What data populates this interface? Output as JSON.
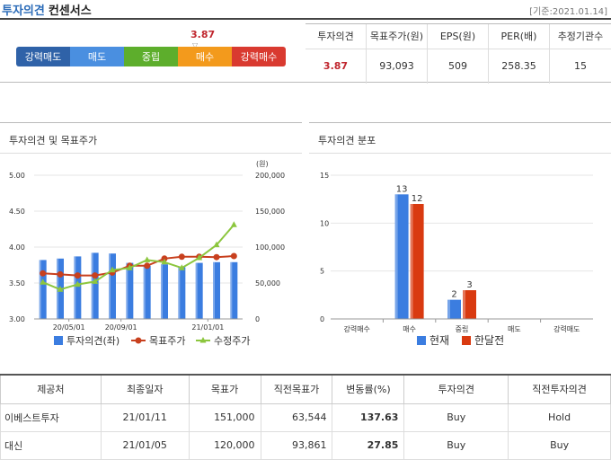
{
  "header": {
    "title": "투자의견",
    "subtitle": "컨센서스",
    "base_date": "[기준:2021.01.14]"
  },
  "consensus": {
    "current_value": "3.87",
    "opinion_scale": [
      "강력매도",
      "매도",
      "중립",
      "매수",
      "강력매수"
    ],
    "opinion_colors": [
      "#2f62a8",
      "#4a8fe0",
      "#5dae2c",
      "#f39a1c",
      "#d93a30"
    ],
    "stats_headers": [
      "투자의견",
      "목표주가(원)",
      "EPS(원)",
      "PER(배)",
      "추정기관수"
    ],
    "stats_values": [
      "3.87",
      "93,093",
      "509",
      "258.35",
      "15"
    ]
  },
  "left_panel": {
    "title": "투자의견 및 목표주가",
    "right_unit": "(원)",
    "legend": [
      "투자의견(좌)",
      "목표주가",
      "수정주가"
    ]
  },
  "right_panel": {
    "title": "투자의견 분포",
    "legend": [
      "현재",
      "한달전"
    ]
  },
  "chart_data": [
    {
      "type": "bar",
      "title": "투자의견 및 목표주가",
      "y_left_ticks": [
        "3.00",
        "3.50",
        "4.00",
        "4.50",
        "5.00"
      ],
      "y_left_range": [
        3.0,
        5.0
      ],
      "y_right_ticks": [
        "0",
        "50,000",
        "100,000",
        "150,000",
        "200,000"
      ],
      "y_right_range": [
        0,
        200000
      ],
      "x_ticks": [
        "20/05/01",
        "20/09/01",
        "21/01/01"
      ],
      "series": [
        {
          "name": "투자의견(좌)",
          "type": "bar",
          "color": "#3b7de0",
          "values": [
            3.82,
            3.84,
            3.87,
            3.92,
            3.91,
            3.78,
            3.74,
            3.76,
            3.72,
            3.78,
            3.79,
            3.79
          ]
        },
        {
          "name": "목표주가",
          "type": "line",
          "color": "#c8401e",
          "values": [
            63500,
            62000,
            60500,
            60500,
            64500,
            74000,
            74000,
            84000,
            86500,
            86500,
            86000,
            87500
          ]
        },
        {
          "name": "수정주가",
          "type": "line",
          "color": "#8cc63e",
          "values": [
            51000,
            41000,
            48000,
            52000,
            68000,
            71000,
            82000,
            79000,
            71000,
            85000,
            103000,
            131000
          ]
        }
      ]
    },
    {
      "type": "bar",
      "title": "투자의견 분포",
      "categories": [
        "강력매수",
        "매수",
        "중립",
        "매도",
        "강력매도"
      ],
      "y_ticks": [
        "0",
        "5",
        "10",
        "15"
      ],
      "y_range": [
        0,
        15
      ],
      "series": [
        {
          "name": "현재",
          "color": "#3b7de0",
          "values": [
            0,
            13,
            2,
            0,
            0
          ]
        },
        {
          "name": "한달전",
          "color": "#d93a10",
          "values": [
            0,
            12,
            3,
            0,
            0
          ]
        }
      ]
    }
  ],
  "table": {
    "headers": [
      "제공처",
      "최종일자",
      "목표가",
      "직전목표가",
      "변동률(%)",
      "투자의견",
      "직전투자의견"
    ],
    "rows": [
      [
        "이베스트투자",
        "21/01/11",
        "151,000",
        "63,544",
        "137.63",
        "Buy",
        "Hold"
      ],
      [
        "대신",
        "21/01/05",
        "120,000",
        "93,861",
        "27.85",
        "Buy",
        "Buy"
      ]
    ]
  }
}
